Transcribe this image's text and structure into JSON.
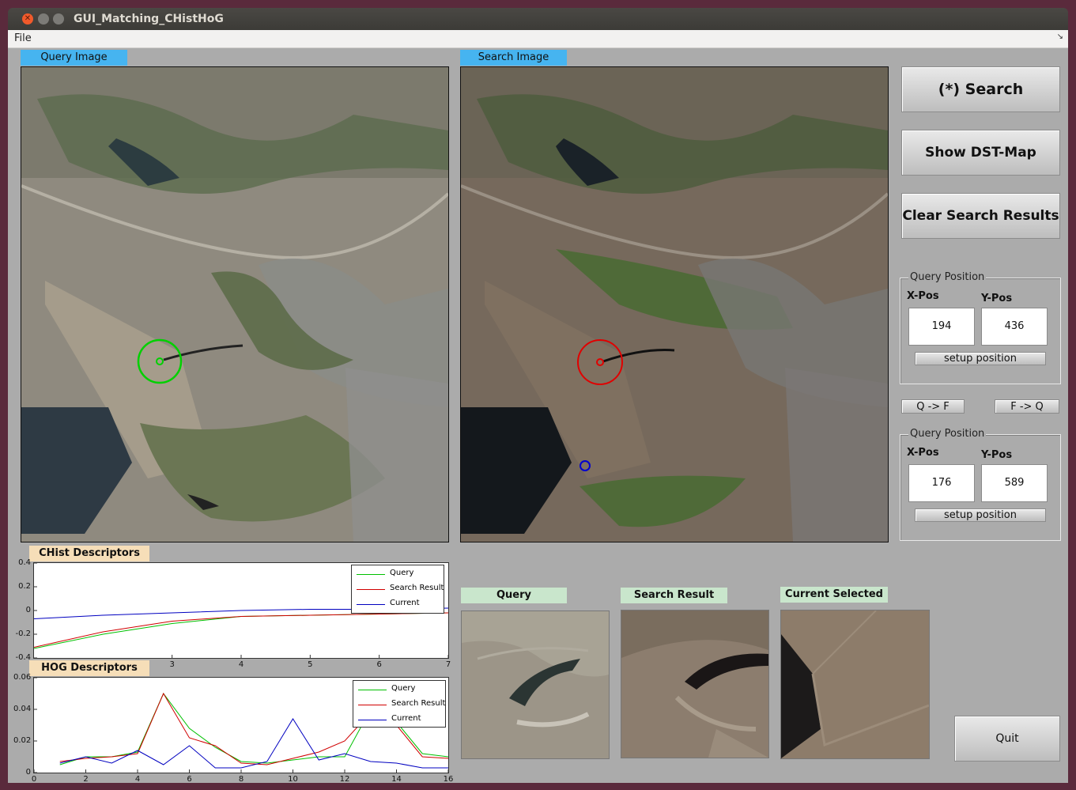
{
  "window": {
    "title": "GUI_Matching_CHistHoG"
  },
  "menu": {
    "items": [
      "File"
    ]
  },
  "panels": {
    "query_image_label": "Query Image",
    "search_image_label": "Search Image"
  },
  "buttons": {
    "search": "(*) Search",
    "show_dst_map": "Show DST-Map",
    "clear_results": "Clear Search Results",
    "q_to_f": "Q -> F",
    "f_to_q": "F -> Q",
    "quit": "Quit"
  },
  "query_position_1": {
    "title": "Query Position",
    "x_label": "X-Pos",
    "y_label": "Y-Pos",
    "x_value": "194",
    "y_value": "436",
    "setup_label": "setup position"
  },
  "query_position_2": {
    "title": "Query Position",
    "x_label": "X-Pos",
    "y_label": "Y-Pos",
    "x_value": "176",
    "y_value": "589",
    "setup_label": "setup position"
  },
  "legend": {
    "query": "Query",
    "search_result": "Search Result",
    "current": "Current"
  },
  "colors": {
    "query": "#00c000",
    "search_result": "#d00000",
    "current": "#0000c0",
    "label_blue": "#46b4f0"
  },
  "thumbnails": {
    "query": "Query",
    "search_result": "Search Result",
    "current_selected": "Current Selected"
  },
  "chart_data": [
    {
      "type": "line",
      "title": "CHist Descriptors",
      "x": [
        1,
        2,
        3,
        4,
        5,
        6,
        7
      ],
      "xticks": [
        "3",
        "4",
        "5",
        "6",
        "7"
      ],
      "yticks": [
        "0.4",
        "0.2",
        "0",
        "-0.2",
        "-0.4"
      ],
      "ylim": [
        -0.4,
        0.4
      ],
      "xlim": [
        1,
        7
      ],
      "series": [
        {
          "name": "Query",
          "values": [
            -0.32,
            -0.2,
            -0.11,
            -0.05,
            -0.04,
            -0.03,
            -0.02
          ]
        },
        {
          "name": "Search Result",
          "values": [
            -0.31,
            -0.18,
            -0.09,
            -0.05,
            -0.04,
            -0.03,
            -0.02
          ]
        },
        {
          "name": "Current",
          "values": [
            -0.07,
            -0.04,
            -0.02,
            0.0,
            0.01,
            0.01,
            0.02
          ]
        }
      ],
      "legend_position": "top-right"
    },
    {
      "type": "line",
      "title": "HOG Descriptors",
      "x": [
        1,
        2,
        3,
        4,
        5,
        6,
        7,
        8,
        9,
        10,
        11,
        12,
        13,
        14,
        15,
        16
      ],
      "xticks": [
        "0",
        "2",
        "4",
        "6",
        "8",
        "10",
        "12",
        "14",
        "16"
      ],
      "yticks": [
        "0.06",
        "0.04",
        "0.02",
        "0"
      ],
      "ylim": [
        0,
        0.06
      ],
      "xlim": [
        0,
        16
      ],
      "series": [
        {
          "name": "Query",
          "values": [
            0.005,
            0.01,
            0.01,
            0.013,
            0.05,
            0.028,
            0.016,
            0.007,
            0.006,
            0.008,
            0.01,
            0.01,
            0.04,
            0.032,
            0.012,
            0.01
          ]
        },
        {
          "name": "Search Result",
          "values": [
            0.007,
            0.009,
            0.01,
            0.012,
            0.05,
            0.022,
            0.017,
            0.006,
            0.005,
            0.009,
            0.013,
            0.02,
            0.038,
            0.03,
            0.01,
            0.009
          ]
        },
        {
          "name": "Current",
          "values": [
            0.006,
            0.01,
            0.006,
            0.014,
            0.005,
            0.017,
            0.003,
            0.003,
            0.007,
            0.034,
            0.008,
            0.012,
            0.007,
            0.006,
            0.003,
            0.003
          ]
        }
      ],
      "legend_position": "top-right"
    }
  ]
}
